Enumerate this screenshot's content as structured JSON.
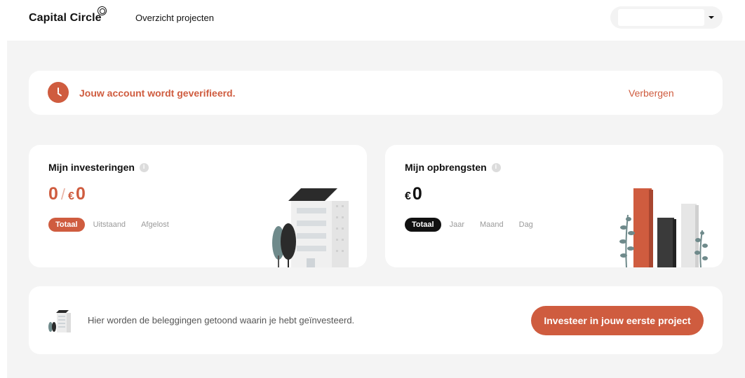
{
  "brand": {
    "name": "Capital Circle"
  },
  "nav": {
    "projects_label": "Overzicht projecten"
  },
  "account_select": {
    "value": ""
  },
  "alert": {
    "message": "Jouw account wordt geverifieerd.",
    "hide_label": "Verbergen",
    "color": "#cf5c3f"
  },
  "investments": {
    "title": "Mijn investeringen",
    "count": "0",
    "separator": "/",
    "currency": "€",
    "amount": "0",
    "filters": [
      "Totaal",
      "Uitstaand",
      "Afgelost"
    ],
    "active_filter": "Totaal"
  },
  "earnings": {
    "title": "Mijn opbrengsten",
    "currency": "€",
    "amount": "0",
    "filters": [
      "Totaal",
      "Jaar",
      "Maand",
      "Dag"
    ],
    "active_filter": "Totaal"
  },
  "empty_state": {
    "text": "Hier worden de beleggingen getoond waarin je hebt geïnvesteerd.",
    "cta_label": "Investeer in jouw eerste project"
  },
  "colors": {
    "accent": "#cf5c3f",
    "background": "#f4f4f4",
    "dark": "#111111"
  }
}
